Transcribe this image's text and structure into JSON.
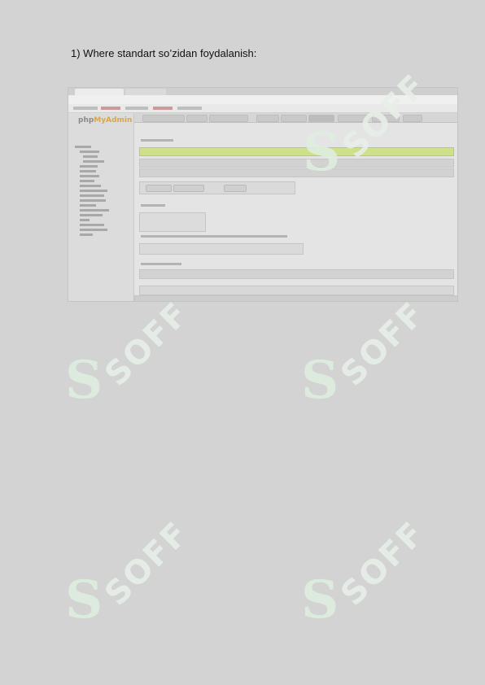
{
  "document": {
    "heading": "1) Where standart so’zidan foydalanish:"
  },
  "watermark": {
    "text": "SOFF",
    "color": "#e8eee8"
  },
  "screenshot": {
    "logo_left": "php",
    "logo_right": "MyAdmin"
  }
}
